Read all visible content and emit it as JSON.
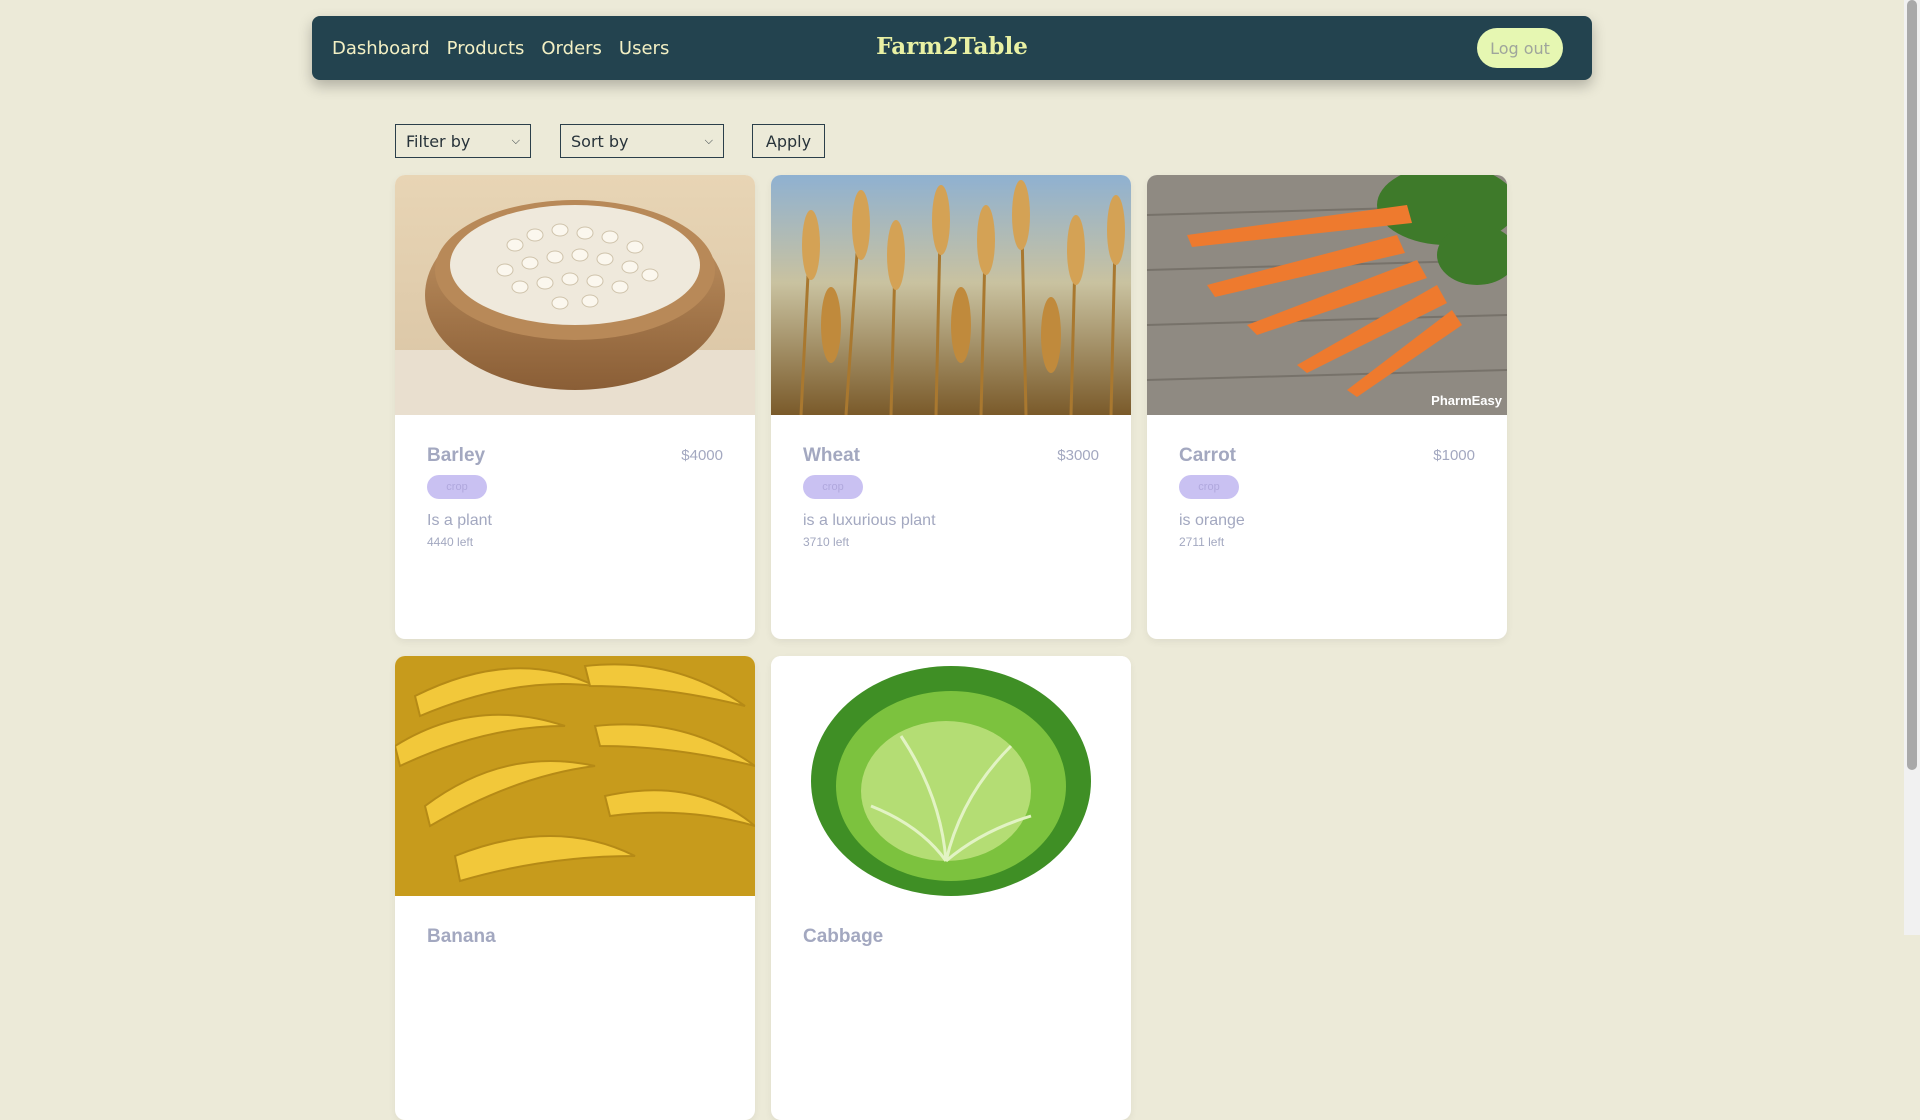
{
  "navbar": {
    "links": [
      "Dashboard",
      "Products",
      "Orders",
      "Users"
    ],
    "brand": "Farm2Table",
    "logout_label": "Log out"
  },
  "controls": {
    "filter_label": "Filter by",
    "sort_label": "Sort by",
    "apply_label": "Apply"
  },
  "products": [
    {
      "name": "Barley",
      "price": "$4000",
      "tag": "crop",
      "description": "Is a plant",
      "stock": "4440 left"
    },
    {
      "name": "Wheat",
      "price": "$3000",
      "tag": "crop",
      "description": "is a luxurious plant",
      "stock": "3710 left"
    },
    {
      "name": "Carrot",
      "price": "$1000",
      "tag": "crop",
      "description": "is orange",
      "stock": "2711 left"
    },
    {
      "name": "Banana",
      "price": "",
      "tag": "",
      "description": "",
      "stock": ""
    },
    {
      "name": "Cabbage",
      "price": "",
      "tag": "",
      "description": "",
      "stock": ""
    }
  ],
  "watermark": "PharmEasy"
}
